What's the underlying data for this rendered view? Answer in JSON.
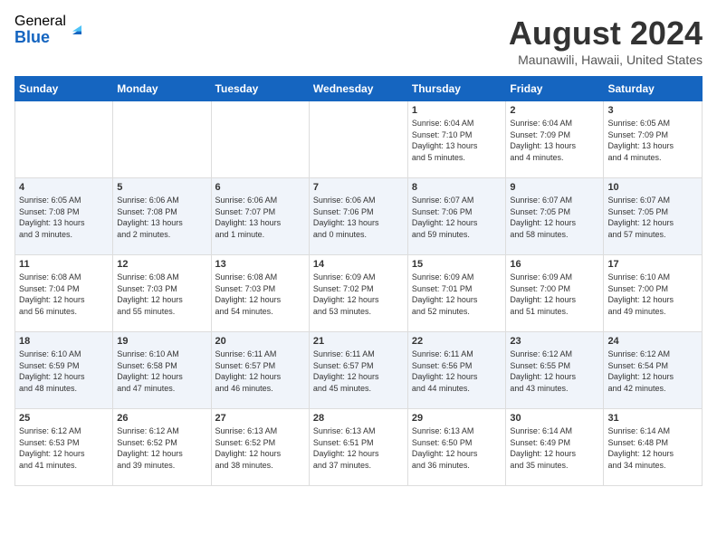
{
  "header": {
    "logo_general": "General",
    "logo_blue": "Blue",
    "month_title": "August 2024",
    "location": "Maunawili, Hawaii, United States"
  },
  "days_of_week": [
    "Sunday",
    "Monday",
    "Tuesday",
    "Wednesday",
    "Thursday",
    "Friday",
    "Saturday"
  ],
  "weeks": [
    [
      {
        "day": "",
        "info": ""
      },
      {
        "day": "",
        "info": ""
      },
      {
        "day": "",
        "info": ""
      },
      {
        "day": "",
        "info": ""
      },
      {
        "day": "1",
        "info": "Sunrise: 6:04 AM\nSunset: 7:10 PM\nDaylight: 13 hours\nand 5 minutes."
      },
      {
        "day": "2",
        "info": "Sunrise: 6:04 AM\nSunset: 7:09 PM\nDaylight: 13 hours\nand 4 minutes."
      },
      {
        "day": "3",
        "info": "Sunrise: 6:05 AM\nSunset: 7:09 PM\nDaylight: 13 hours\nand 4 minutes."
      }
    ],
    [
      {
        "day": "4",
        "info": "Sunrise: 6:05 AM\nSunset: 7:08 PM\nDaylight: 13 hours\nand 3 minutes."
      },
      {
        "day": "5",
        "info": "Sunrise: 6:06 AM\nSunset: 7:08 PM\nDaylight: 13 hours\nand 2 minutes."
      },
      {
        "day": "6",
        "info": "Sunrise: 6:06 AM\nSunset: 7:07 PM\nDaylight: 13 hours\nand 1 minute."
      },
      {
        "day": "7",
        "info": "Sunrise: 6:06 AM\nSunset: 7:06 PM\nDaylight: 13 hours\nand 0 minutes."
      },
      {
        "day": "8",
        "info": "Sunrise: 6:07 AM\nSunset: 7:06 PM\nDaylight: 12 hours\nand 59 minutes."
      },
      {
        "day": "9",
        "info": "Sunrise: 6:07 AM\nSunset: 7:05 PM\nDaylight: 12 hours\nand 58 minutes."
      },
      {
        "day": "10",
        "info": "Sunrise: 6:07 AM\nSunset: 7:05 PM\nDaylight: 12 hours\nand 57 minutes."
      }
    ],
    [
      {
        "day": "11",
        "info": "Sunrise: 6:08 AM\nSunset: 7:04 PM\nDaylight: 12 hours\nand 56 minutes."
      },
      {
        "day": "12",
        "info": "Sunrise: 6:08 AM\nSunset: 7:03 PM\nDaylight: 12 hours\nand 55 minutes."
      },
      {
        "day": "13",
        "info": "Sunrise: 6:08 AM\nSunset: 7:03 PM\nDaylight: 12 hours\nand 54 minutes."
      },
      {
        "day": "14",
        "info": "Sunrise: 6:09 AM\nSunset: 7:02 PM\nDaylight: 12 hours\nand 53 minutes."
      },
      {
        "day": "15",
        "info": "Sunrise: 6:09 AM\nSunset: 7:01 PM\nDaylight: 12 hours\nand 52 minutes."
      },
      {
        "day": "16",
        "info": "Sunrise: 6:09 AM\nSunset: 7:00 PM\nDaylight: 12 hours\nand 51 minutes."
      },
      {
        "day": "17",
        "info": "Sunrise: 6:10 AM\nSunset: 7:00 PM\nDaylight: 12 hours\nand 49 minutes."
      }
    ],
    [
      {
        "day": "18",
        "info": "Sunrise: 6:10 AM\nSunset: 6:59 PM\nDaylight: 12 hours\nand 48 minutes."
      },
      {
        "day": "19",
        "info": "Sunrise: 6:10 AM\nSunset: 6:58 PM\nDaylight: 12 hours\nand 47 minutes."
      },
      {
        "day": "20",
        "info": "Sunrise: 6:11 AM\nSunset: 6:57 PM\nDaylight: 12 hours\nand 46 minutes."
      },
      {
        "day": "21",
        "info": "Sunrise: 6:11 AM\nSunset: 6:57 PM\nDaylight: 12 hours\nand 45 minutes."
      },
      {
        "day": "22",
        "info": "Sunrise: 6:11 AM\nSunset: 6:56 PM\nDaylight: 12 hours\nand 44 minutes."
      },
      {
        "day": "23",
        "info": "Sunrise: 6:12 AM\nSunset: 6:55 PM\nDaylight: 12 hours\nand 43 minutes."
      },
      {
        "day": "24",
        "info": "Sunrise: 6:12 AM\nSunset: 6:54 PM\nDaylight: 12 hours\nand 42 minutes."
      }
    ],
    [
      {
        "day": "25",
        "info": "Sunrise: 6:12 AM\nSunset: 6:53 PM\nDaylight: 12 hours\nand 41 minutes."
      },
      {
        "day": "26",
        "info": "Sunrise: 6:12 AM\nSunset: 6:52 PM\nDaylight: 12 hours\nand 39 minutes."
      },
      {
        "day": "27",
        "info": "Sunrise: 6:13 AM\nSunset: 6:52 PM\nDaylight: 12 hours\nand 38 minutes."
      },
      {
        "day": "28",
        "info": "Sunrise: 6:13 AM\nSunset: 6:51 PM\nDaylight: 12 hours\nand 37 minutes."
      },
      {
        "day": "29",
        "info": "Sunrise: 6:13 AM\nSunset: 6:50 PM\nDaylight: 12 hours\nand 36 minutes."
      },
      {
        "day": "30",
        "info": "Sunrise: 6:14 AM\nSunset: 6:49 PM\nDaylight: 12 hours\nand 35 minutes."
      },
      {
        "day": "31",
        "info": "Sunrise: 6:14 AM\nSunset: 6:48 PM\nDaylight: 12 hours\nand 34 minutes."
      }
    ]
  ]
}
